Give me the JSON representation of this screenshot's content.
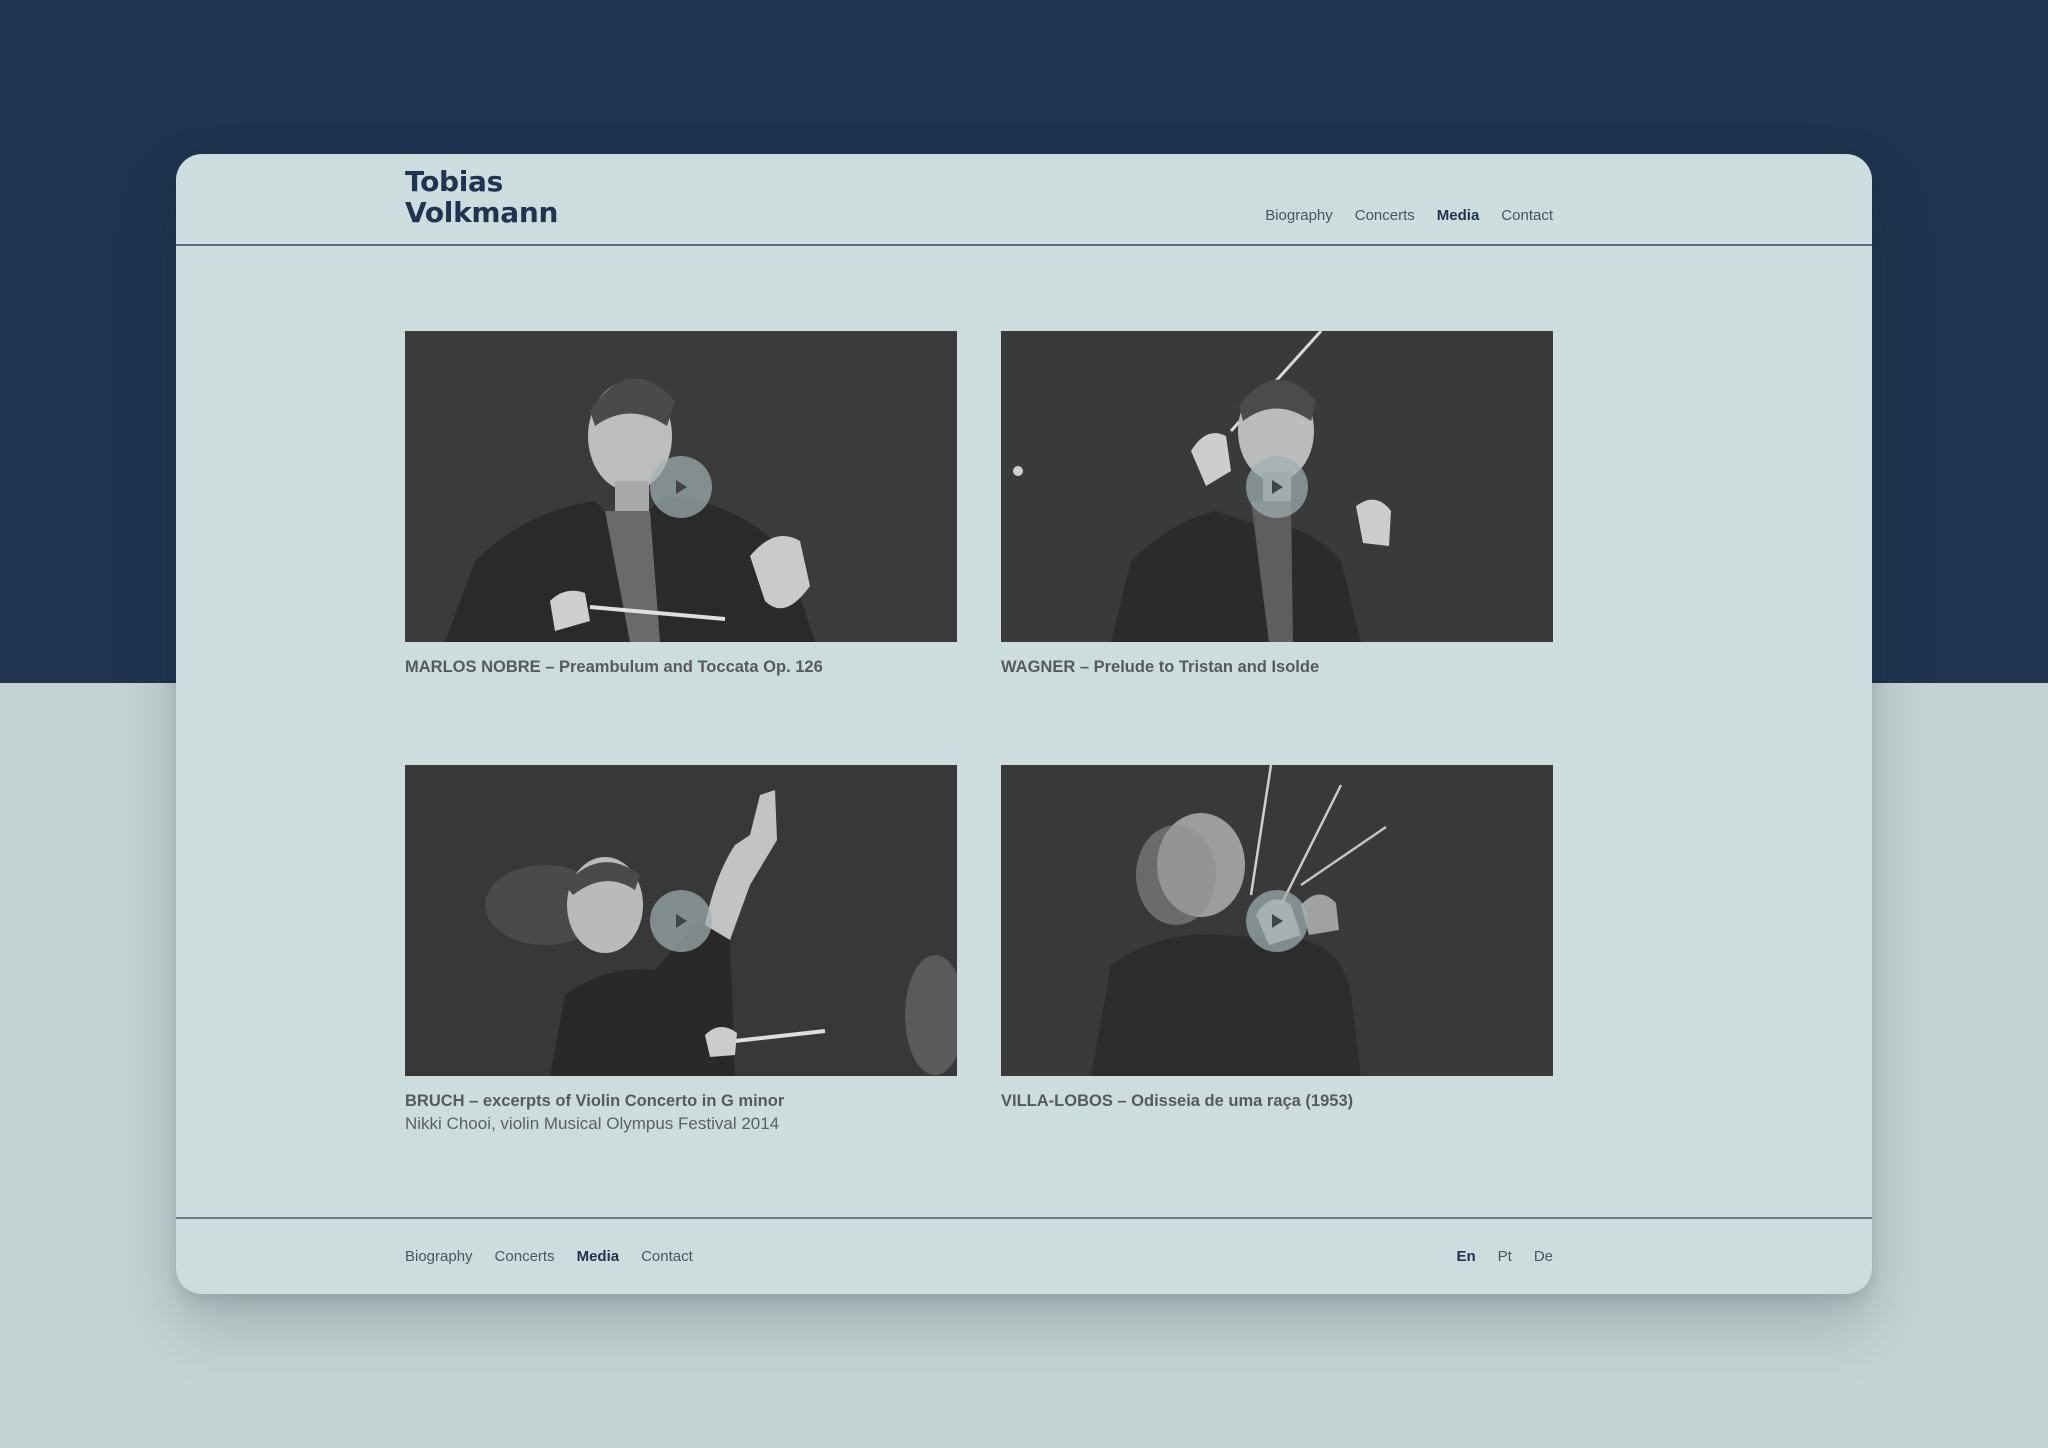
{
  "site": {
    "name_line1": "Tobias",
    "name_line2": "Volkmann"
  },
  "nav": {
    "items": [
      {
        "label": "Biography",
        "active": false
      },
      {
        "label": "Concerts",
        "active": false
      },
      {
        "label": "Media",
        "active": true
      },
      {
        "label": "Contact",
        "active": false
      }
    ]
  },
  "media": {
    "items": [
      {
        "title": "MARLOS NOBRE – Preambulum and Toccata Op. 126",
        "subtitle": ""
      },
      {
        "title": "WAGNER – Prelude to Tristan and Isolde",
        "subtitle": ""
      },
      {
        "title": "BRUCH – excerpts of Violin Concerto in G minor",
        "subtitle": "Nikki Chooi, violin Musical Olympus Festival 2014"
      },
      {
        "title": "VILLA-LOBOS – Odisseia de uma raça (1953)",
        "subtitle": ""
      }
    ]
  },
  "footer": {
    "nav": [
      {
        "label": "Biography",
        "active": false
      },
      {
        "label": "Concerts",
        "active": false
      },
      {
        "label": "Media",
        "active": true
      },
      {
        "label": "Contact",
        "active": false
      }
    ],
    "languages": [
      {
        "label": "En",
        "active": true
      },
      {
        "label": "Pt",
        "active": false
      },
      {
        "label": "De",
        "active": false
      }
    ]
  },
  "colors": {
    "page_dark": "#203451",
    "page_light": "#c5d3d3",
    "panel": "#cddddd",
    "accent": "#203451",
    "photo_bg": "#3e3e3e"
  },
  "icons": {
    "play": "play-icon"
  }
}
